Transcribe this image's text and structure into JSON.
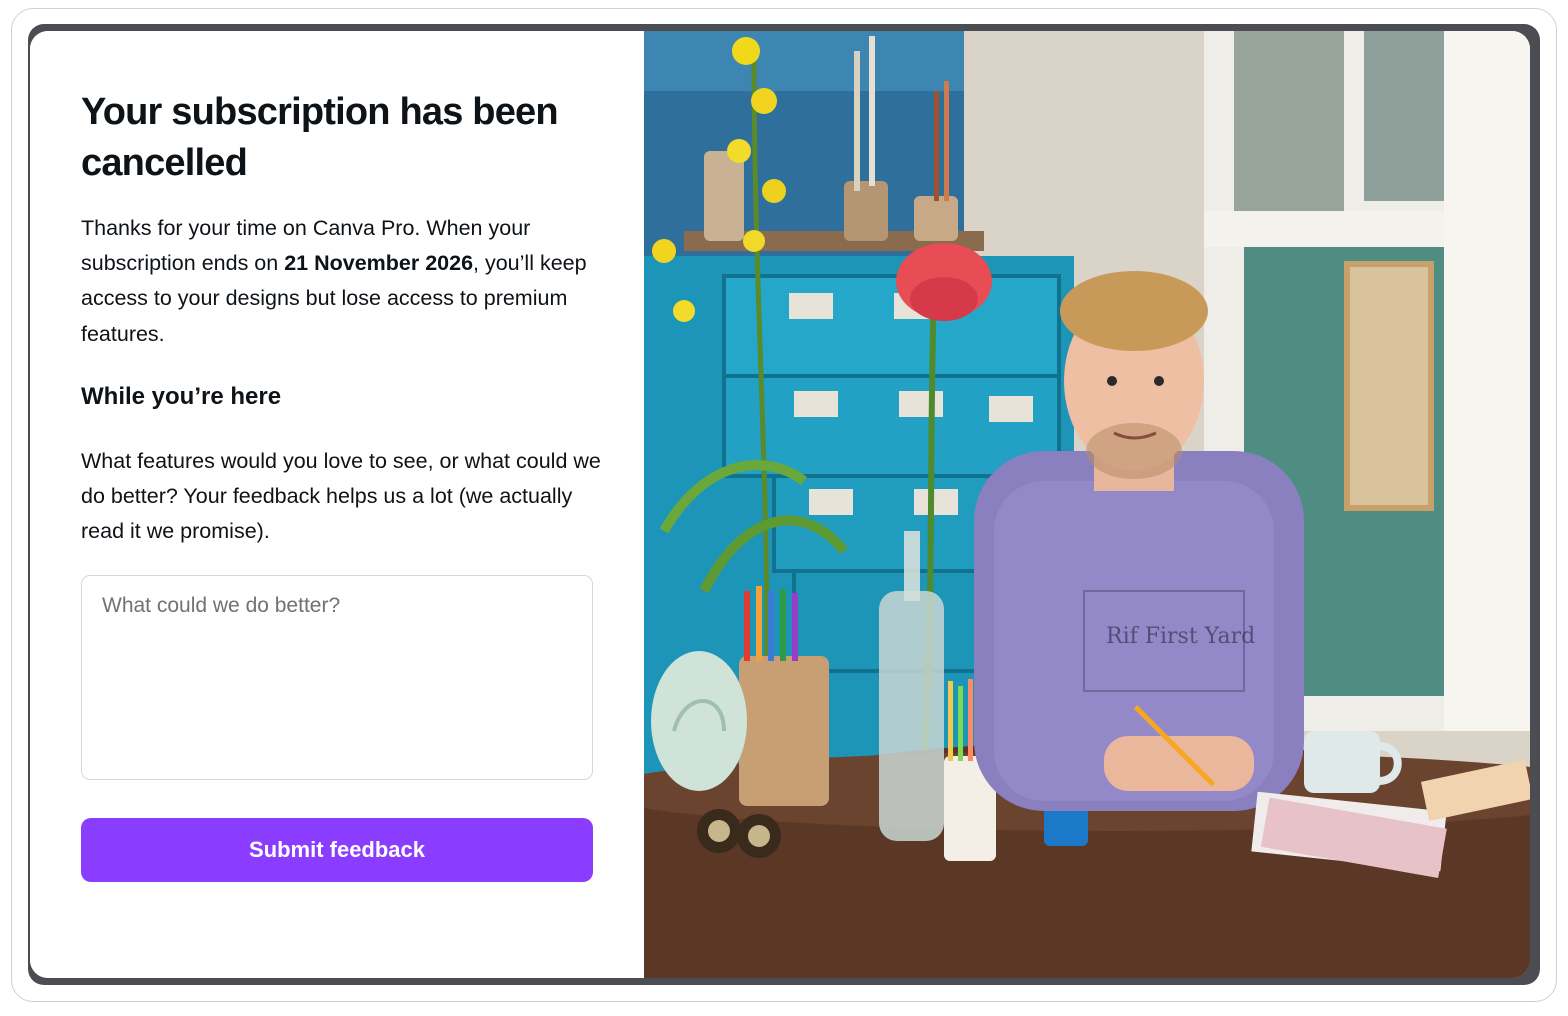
{
  "dialog": {
    "title": "Your subscription has been cancelled",
    "body_prefix": "Thanks for your time on Canva Pro. When your subscription ends on ",
    "end_date": "21 November 2026",
    "body_suffix": ", you’ll keep access to your designs but lose access to premium features.",
    "section_heading": "While you’re here",
    "feedback_prompt": "What features would you love to see, or what could we do better? Your feedback helps us a lot (we actually read it we promise).",
    "feedback_input": {
      "value": "",
      "placeholder": "What could we do better?"
    },
    "submit_label": "Submit feedback"
  },
  "hero_image": {
    "description": "photo",
    "sweatshirt_print": "Rif First Yard"
  },
  "colors": {
    "accent": "#8b3dff",
    "text": "#0e1318",
    "backdrop": "#4c4d52"
  }
}
